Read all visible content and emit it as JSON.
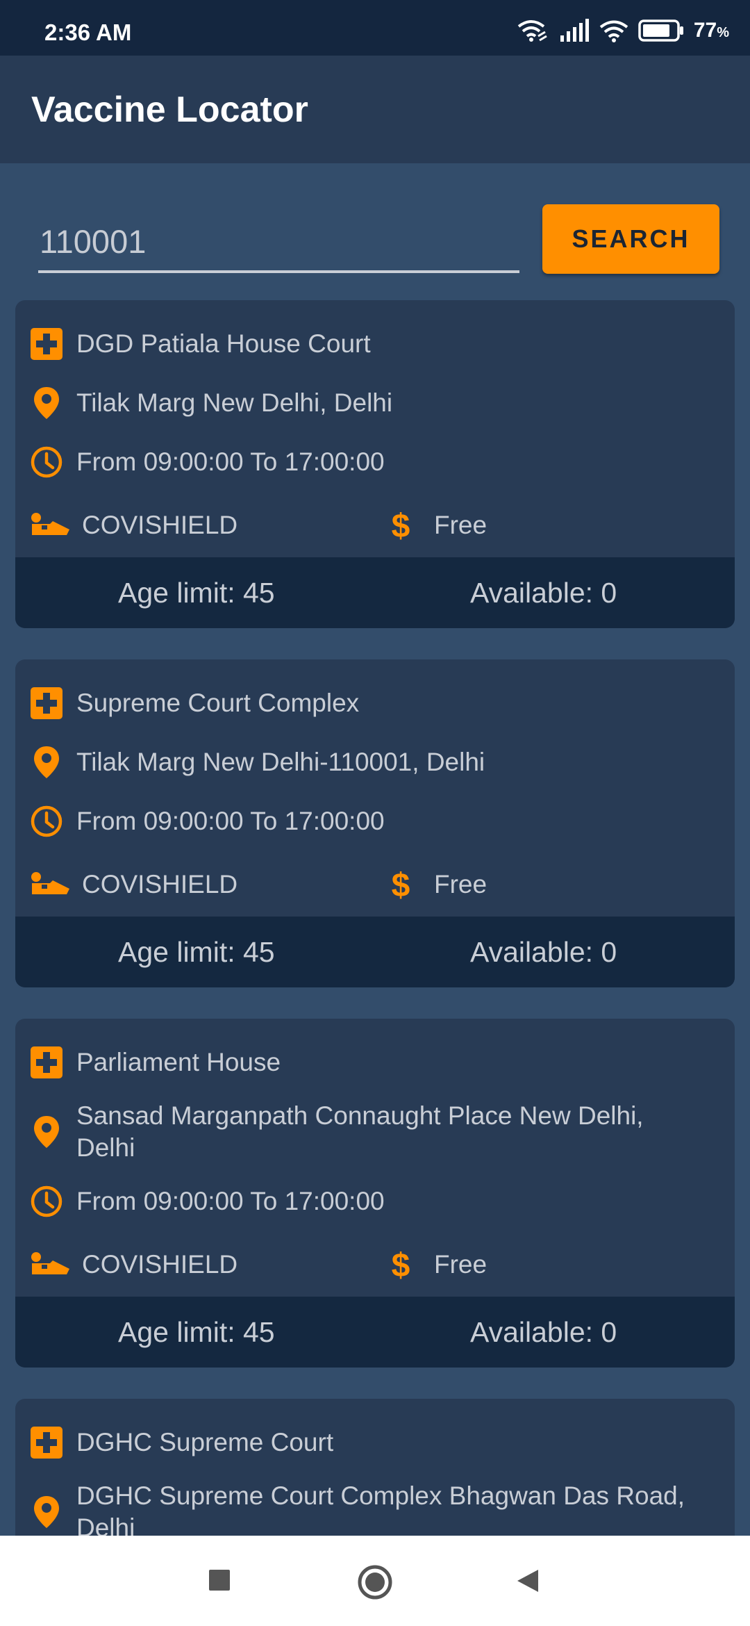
{
  "status_bar": {
    "time": "2:36 AM",
    "battery_percent": "77",
    "battery_unit": "%",
    "icons": [
      "wifi-link-icon",
      "signal-icon",
      "wifi-icon",
      "battery-icon"
    ]
  },
  "app_bar": {
    "title": "Vaccine Locator"
  },
  "search": {
    "value": "110001",
    "button_label": "SEARCH"
  },
  "colors": {
    "accent": "#ff8f00",
    "background": "#334d6b",
    "card": "#283b55",
    "card_footer": "#142840",
    "text": "#c9ced6"
  },
  "centers": [
    {
      "name": "DGD Patiala House Court",
      "address": "Tilak Marg New Delhi, Delhi",
      "hours": "From 09:00:00 To 17:00:00",
      "vaccine": "COVISHIELD",
      "fee": "Free",
      "age_limit": "Age limit: 45",
      "available": "Available: 0"
    },
    {
      "name": "Supreme Court Complex",
      "address": "Tilak Marg New Delhi-110001, Delhi",
      "hours": "From 09:00:00 To 17:00:00",
      "vaccine": "COVISHIELD",
      "fee": "Free",
      "age_limit": "Age limit: 45",
      "available": "Available: 0"
    },
    {
      "name": "Parliament House",
      "address": "Sansad Marganpath Connaught Place New Delhi, Delhi",
      "hours": "From 09:00:00 To 17:00:00",
      "vaccine": "COVISHIELD",
      "fee": "Free",
      "age_limit": "Age limit: 45",
      "available": "Available: 0"
    },
    {
      "name": "DGHC Supreme Court",
      "address": "DGHC Supreme Court Complex Bhagwan Das Road, Delhi"
    }
  ]
}
